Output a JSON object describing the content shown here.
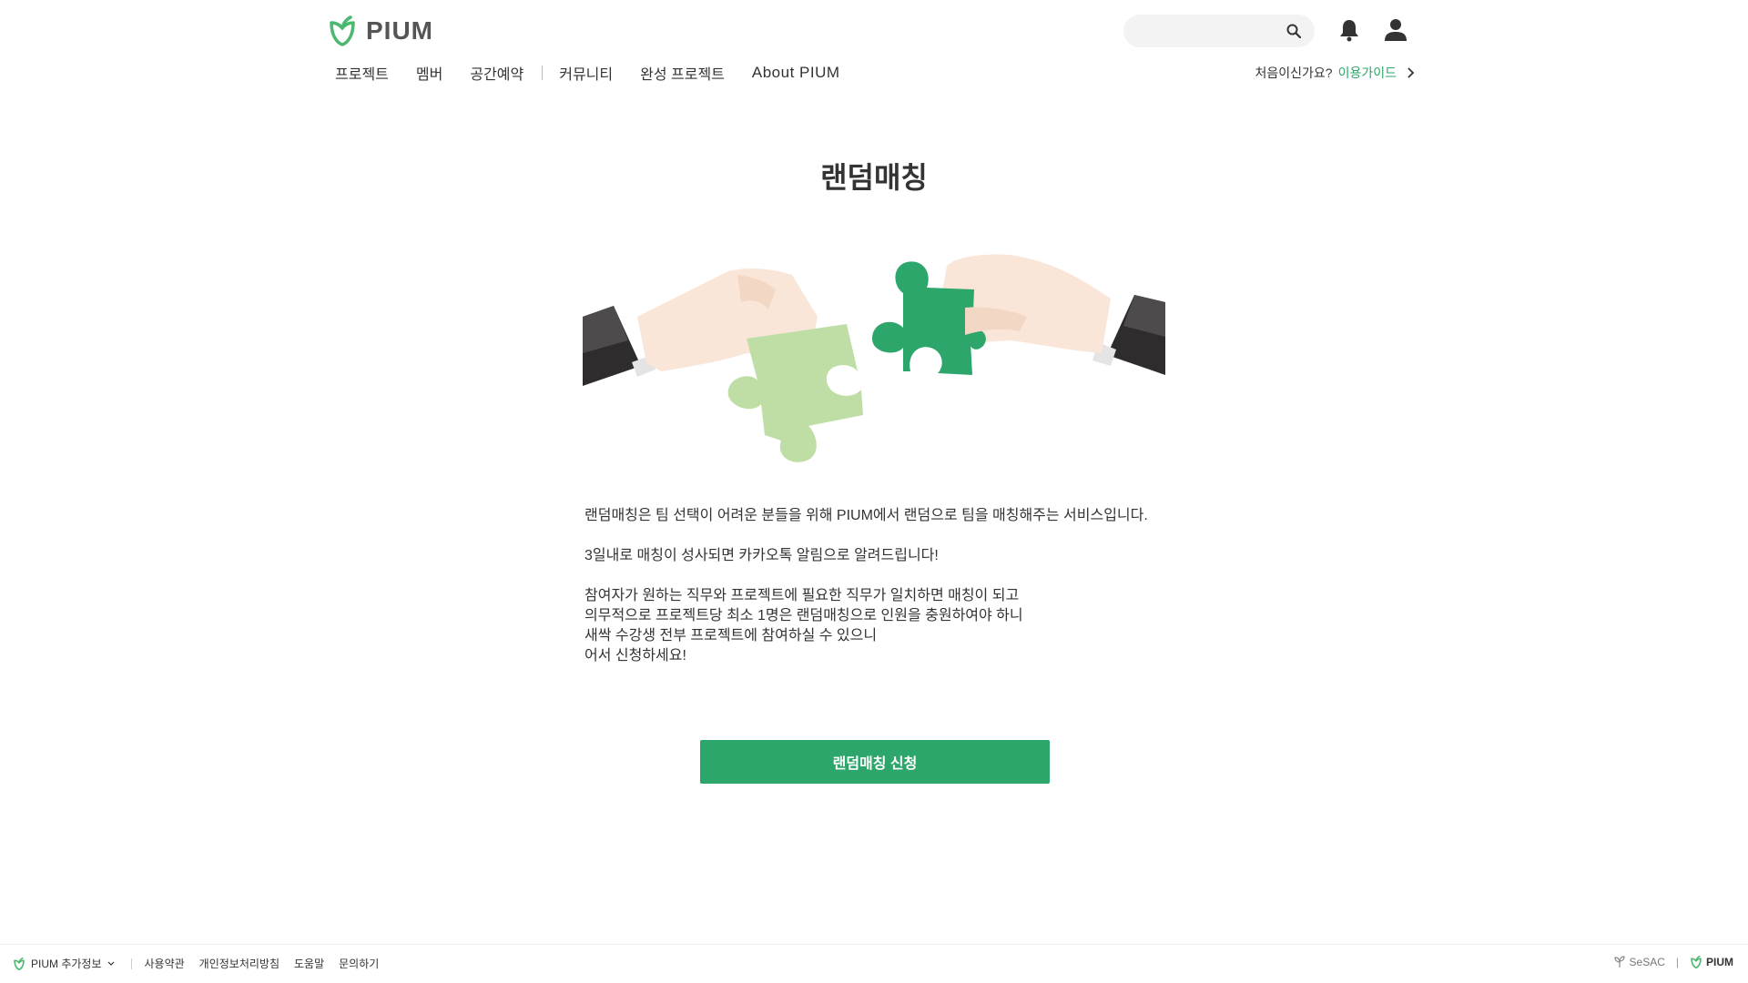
{
  "header": {
    "logo_text": "PIUM",
    "search": {
      "placeholder": ""
    },
    "nav": [
      {
        "label": "프로젝트"
      },
      {
        "label": "멤버"
      },
      {
        "label": "공간예약"
      },
      {
        "label": "커뮤니티"
      },
      {
        "label": "완성 프로젝트"
      },
      {
        "label": "About PIUM"
      }
    ],
    "guide": {
      "prompt": "처음이신가요?",
      "link": "이용가이드"
    }
  },
  "main": {
    "title": "랜덤매칭",
    "paragraphs": [
      "랜덤매칭은 팀 선택이 어려운 분들을 위해 PIUM에서 랜덤으로 팀을 매칭해주는 서비스입니다.",
      "3일내로 매칭이 성사되면 카카오톡 알림으로 알려드립니다!"
    ],
    "paragraph_lines": [
      "참여자가 원하는 직무와 프로젝트에 필요한 직무가 일치하면 매칭이 되고",
      "의무적으로 프로젝트당 최소 1명은 랜덤매칭으로 인원을 충원하여야 하니",
      "새싹 수강생 전부 프로젝트에 참여하실 수 있으니",
      "어서 신청하세요!"
    ],
    "apply_button": "랜덤매칭 신청"
  },
  "footer": {
    "info": "PIUM 추가정보",
    "links": [
      "사용약관",
      "개인정보처리방침",
      "도움말",
      "문의하기"
    ],
    "sesac": "SeSAC",
    "pium": "PIUM"
  },
  "colors": {
    "accent": "#2ca66a",
    "puzzle_light": "#bfdea5",
    "puzzle_dark": "#2ca66a",
    "skin": "#f9e6d8"
  }
}
